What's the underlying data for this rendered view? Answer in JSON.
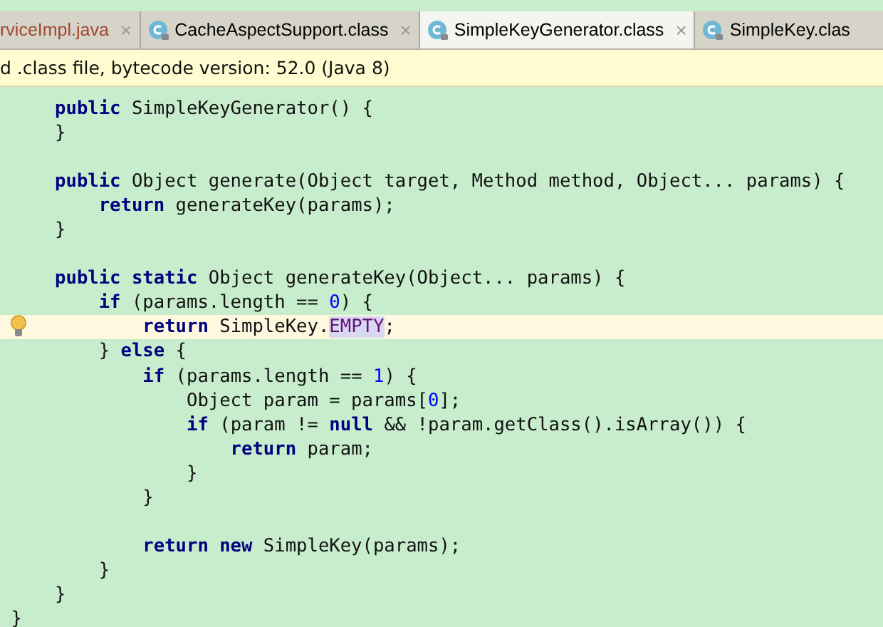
{
  "tabs": [
    {
      "label": "rviceImpl.java",
      "selected": false,
      "kind": "java",
      "color": "#a2462e",
      "close": "×"
    },
    {
      "label": "CacheAspectSupport.class",
      "selected": false,
      "kind": "class",
      "color": "#000000",
      "close": "×"
    },
    {
      "label": "SimpleKeyGenerator.class",
      "selected": true,
      "kind": "class",
      "color": "#000000",
      "close": "×"
    },
    {
      "label": "SimpleKey.clas",
      "selected": false,
      "kind": "class",
      "color": "#000000"
    }
  ],
  "banner": {
    "text": "d .class file, bytecode version: 52.0 (Java 8)"
  },
  "code_lines": [
    {
      "current": false,
      "tokens": [
        {
          "kind": "keyword",
          "text": "    public"
        },
        {
          "kind": "plain",
          "text": " SimpleKeyGenerator() {"
        }
      ]
    },
    {
      "current": false,
      "tokens": [
        {
          "kind": "plain",
          "text": "    }"
        }
      ]
    },
    {
      "current": false
    },
    {
      "current": false,
      "tokens": [
        {
          "kind": "keyword",
          "text": "    public"
        },
        {
          "kind": "plain",
          "text": " Object generate(Object target, Method method, Object... params) {"
        }
      ]
    },
    {
      "current": false,
      "tokens": [
        {
          "kind": "keyword",
          "text": "        return"
        },
        {
          "kind": "plain",
          "text": " generateKey(params);"
        }
      ]
    },
    {
      "current": false,
      "tokens": [
        {
          "kind": "plain",
          "text": "    }"
        }
      ]
    },
    {
      "current": false
    },
    {
      "current": false,
      "tokens": [
        {
          "kind": "keyword",
          "text": "    public static"
        },
        {
          "kind": "plain",
          "text": " Object generateKey(Object... params) {"
        }
      ]
    },
    {
      "current": false,
      "tokens": [
        {
          "kind": "keyword",
          "text": "        if"
        },
        {
          "kind": "plain",
          "text": " (params.length == "
        },
        {
          "kind": "number",
          "text": "0"
        },
        {
          "kind": "plain",
          "text": ") {"
        }
      ]
    },
    {
      "current": true,
      "bulb": true,
      "tokens": [
        {
          "kind": "keyword",
          "text": "            return"
        },
        {
          "kind": "plain",
          "text": " SimpleKey."
        },
        {
          "kind": "field",
          "text": "EMPTY"
        },
        {
          "kind": "plain",
          "text": ";"
        }
      ]
    },
    {
      "current": false,
      "tokens": [
        {
          "kind": "plain",
          "text": "        } "
        },
        {
          "kind": "keyword",
          "text": "else"
        },
        {
          "kind": "plain",
          "text": " {"
        }
      ]
    },
    {
      "current": false,
      "tokens": [
        {
          "kind": "keyword",
          "text": "            if"
        },
        {
          "kind": "plain",
          "text": " (params.length == "
        },
        {
          "kind": "number",
          "text": "1"
        },
        {
          "kind": "plain",
          "text": ") {"
        }
      ]
    },
    {
      "current": false,
      "tokens": [
        {
          "kind": "plain",
          "text": "                Object param = params["
        },
        {
          "kind": "number",
          "text": "0"
        },
        {
          "kind": "plain",
          "text": "];"
        }
      ]
    },
    {
      "current": false,
      "tokens": [
        {
          "kind": "keyword",
          "text": "                if"
        },
        {
          "kind": "plain",
          "text": " (param != "
        },
        {
          "kind": "keyword",
          "text": "null"
        },
        {
          "kind": "plain",
          "text": " && !param.getClass().isArray()) {"
        }
      ]
    },
    {
      "current": false,
      "tokens": [
        {
          "kind": "keyword",
          "text": "                    return"
        },
        {
          "kind": "plain",
          "text": " param;"
        }
      ]
    },
    {
      "current": false,
      "tokens": [
        {
          "kind": "plain",
          "text": "                }"
        }
      ]
    },
    {
      "current": false,
      "tokens": [
        {
          "kind": "plain",
          "text": "            }"
        }
      ]
    },
    {
      "current": false
    },
    {
      "current": false,
      "tokens": [
        {
          "kind": "keyword",
          "text": "            return new"
        },
        {
          "kind": "plain",
          "text": " SimpleKey(params);"
        }
      ]
    },
    {
      "current": false,
      "tokens": [
        {
          "kind": "plain",
          "text": "        }"
        }
      ]
    },
    {
      "current": false,
      "tokens": [
        {
          "kind": "plain",
          "text": "    }"
        }
      ]
    },
    {
      "current": false,
      "tokens": [
        {
          "kind": "plain",
          "text": "}"
        }
      ]
    }
  ]
}
